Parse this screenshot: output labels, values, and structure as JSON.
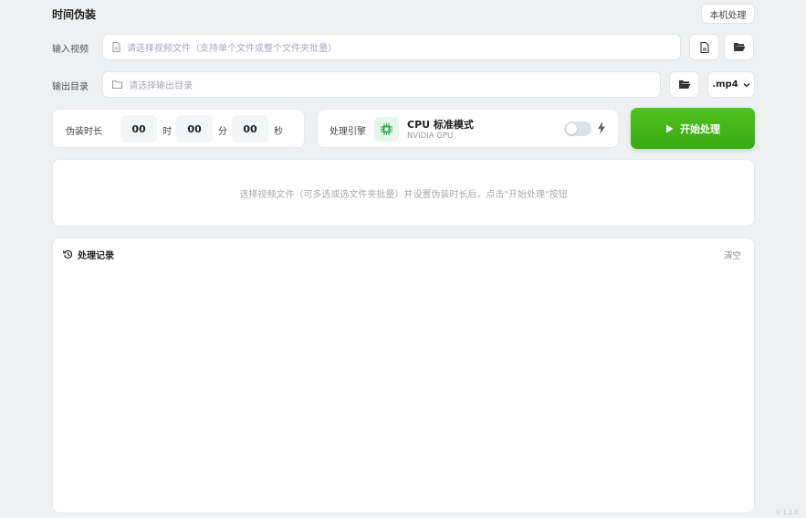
{
  "header": {
    "title": "时间伪装",
    "local_button": "本机处理"
  },
  "input_row": {
    "label": "输入视频",
    "placeholder": "请选择视频文件（支持单个文件或整个文件夹批量）"
  },
  "output_row": {
    "label": "输出目录",
    "placeholder": "请选择输出目录",
    "format": ".mp4"
  },
  "duration": {
    "label": "伪装时长",
    "hours": "00",
    "hours_unit": "时",
    "minutes": "00",
    "minutes_unit": "分",
    "seconds": "00",
    "seconds_unit": "秒"
  },
  "engine": {
    "label": "处理引擎",
    "name": "CPU 标准模式",
    "sub": "NVIDIA GPU",
    "toggle_on": false
  },
  "start_button": "开始处理",
  "drop_hint": "选择视频文件（可多选或选文件夹批量）并设置伪装时长后，点击\"开始处理\"按钮",
  "log": {
    "title": "处理记录",
    "clear": "清空"
  },
  "version": "V 1.1.0",
  "colors": {
    "accent": "#3fb21a",
    "background": "#eef0f2"
  }
}
